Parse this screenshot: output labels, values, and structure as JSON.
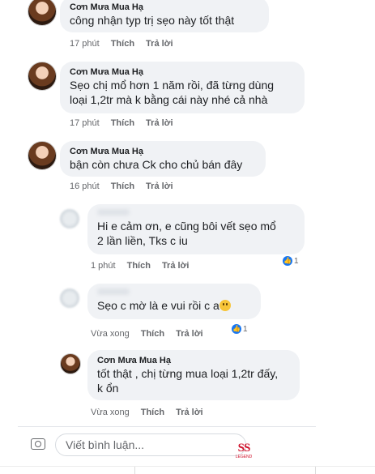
{
  "comments": [
    {
      "name": "Cơn Mưa Mua Hạ",
      "text": "công nhận typ trị sẹo này tốt thật",
      "time": "17 phút",
      "like": "Thích",
      "reply": "Trả lời"
    },
    {
      "name": "Cơn Mưa Mua Hạ",
      "text": "Sẹo chị mổ hơn 1 năm rồi, đã từng dùng\nloại 1,2tr mà k bằng cái này nhé cả nhà",
      "time": "17 phút",
      "like": "Thích",
      "reply": "Trả lời"
    },
    {
      "name": "Cơn Mưa Mua Hạ",
      "text": "bận còn chưa Ck cho chủ bán đây",
      "time": "16 phút",
      "like": "Thích",
      "reply": "Trả lời"
    },
    {
      "name": "",
      "text": "Hi e cảm ơn, e cũng bôi vết sẹo mổ\n2 lần liền, Tks c iu",
      "time": "1 phút",
      "like": "Thích",
      "reply": "Trả lời",
      "reactions": "1"
    },
    {
      "name": "",
      "text": "Sẹo c mờ là e vui rồi c a",
      "time": "Vừa xong",
      "like": "Thích",
      "reply": "Trả lời",
      "reactions": "1"
    },
    {
      "name": "Cơn Mưa Mua Hạ",
      "text": "tốt thật , chị từng mua loại 1,2tr đấy,\nk ổn",
      "time": "Vừa xong",
      "like": "Thích",
      "reply": "Trả lời"
    }
  ],
  "composer": {
    "placeholder": "Viết bình luận...",
    "camera_icon": "camera-icon"
  },
  "watermark": {
    "text": "SS",
    "subtext": "LEGEND"
  },
  "colors": {
    "bubble": "#f0f2f5",
    "meta": "#65676b",
    "like_blue": "#1877f2",
    "watermark_red": "#d0112b"
  }
}
